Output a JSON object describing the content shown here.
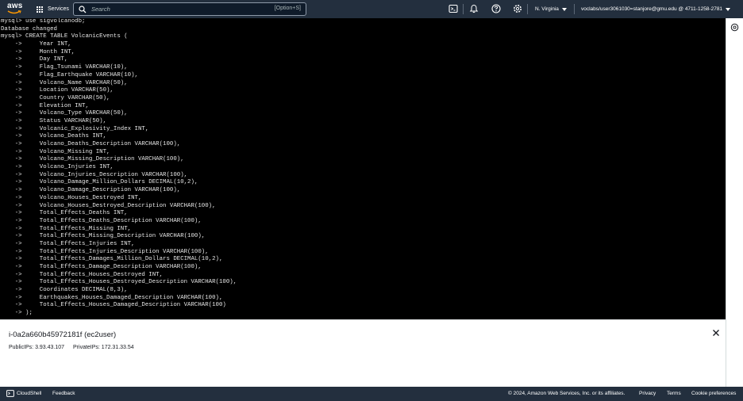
{
  "topbar": {
    "logo_text": "aws",
    "services_label": "Services",
    "search_placeholder": "Search",
    "search_shortcut": "[Option+S]",
    "region_label": "N. Virginia",
    "account_label": "voclabs/user3061030=stanjore@gmu.edu @ 4711-1258-2781"
  },
  "terminal": {
    "lines": [
      "mysql> use sigvolcanodb;",
      "Database changed",
      "mysql> CREATE TABLE VolcanicEvents (",
      "    ->     Year INT,",
      "    ->     Month INT,",
      "    ->     Day INT,",
      "    ->     Flag_Tsunami VARCHAR(10),",
      "    ->     Flag_Earthquake VARCHAR(10),",
      "    ->     Volcano_Name VARCHAR(50),",
      "    ->     Location VARCHAR(50),",
      "    ->     Country VARCHAR(50),",
      "    ->     Elevation INT,",
      "    ->     Volcano_Type VARCHAR(50),",
      "    ->     Status VARCHAR(50),",
      "    ->     Volcanic_Explosivity_Index INT,",
      "    ->     Volcano_Deaths INT,",
      "    ->     Volcano_Deaths_Description VARCHAR(100),",
      "    ->     Volcano_Missing INT,",
      "    ->     Volcano_Missing_Description VARCHAR(100),",
      "    ->     Volcano_Injuries INT,",
      "    ->     Volcano_Injuries_Description VARCHAR(100),",
      "    ->     Volcano_Damage_Million_Dollars DECIMAL(10,2),",
      "    ->     Volcano_Damage_Description VARCHAR(100),",
      "    ->     Volcano_Houses_Destroyed INT,",
      "    ->     Volcano_Houses_Destroyed_Description VARCHAR(100),",
      "    ->     Total_Effects_Deaths INT,",
      "    ->     Total_Effects_Deaths_Description VARCHAR(100),",
      "    ->     Total_Effects_Missing INT,",
      "    ->     Total_Effects_Missing_Description VARCHAR(100),",
      "    ->     Total_Effects_Injuries INT,",
      "    ->     Total_Effects_Injuries_Description VARCHAR(100),",
      "    ->     Total_Effects_Damages_Million_Dollars DECIMAL(10,2),",
      "    ->     Total_Effects_Damage_Description VARCHAR(100),",
      "    ->     Total_Effects_Houses_Destroyed INT,",
      "    ->     Total_Effects_Houses_Destroyed_Description VARCHAR(100),",
      "    ->     Coordinates DECIMAL(8,3),",
      "    ->     Earthquakes_Houses_Damaged_Description VARCHAR(100),",
      "    ->     Total_Effects_Houses_Damaged_Description VARCHAR(100)",
      "    -> );"
    ]
  },
  "instance_panel": {
    "title": "i-0a2a660b45972181f (ec2user)",
    "public_ips": "PublicIPs: 3.93.43.107",
    "private_ips": "PrivateIPs: 172.31.33.54"
  },
  "footer": {
    "cloudshell_label": "CloudShell",
    "feedback_label": "Feedback",
    "copyright": "© 2024, Amazon Web Services, Inc. or its affiliates.",
    "privacy_label": "Privacy",
    "terms_label": "Terms",
    "cookie_label": "Cookie preferences"
  },
  "colors": {
    "nav_bg": "#232f3e",
    "terminal_bg": "#000000",
    "terminal_text": "#e6e6e6",
    "logo_smile": "#ff9900"
  }
}
